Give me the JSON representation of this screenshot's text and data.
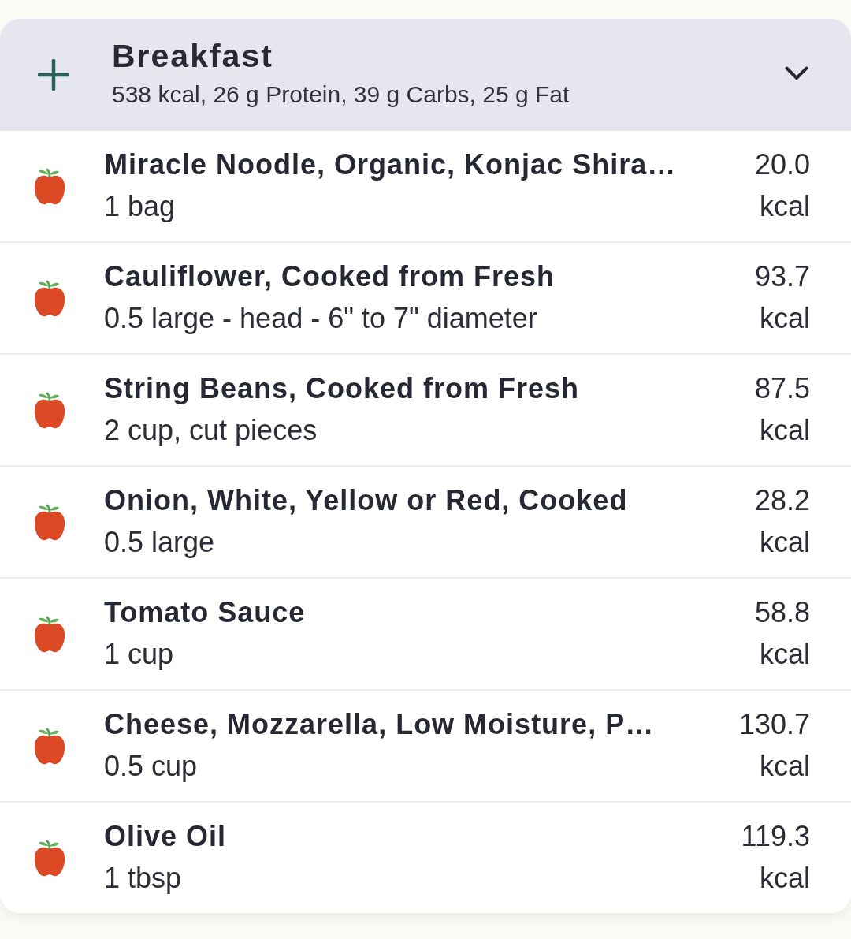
{
  "meal": {
    "title": "Breakfast",
    "summary": "538 kcal, 26 g Protein, 39 g Carbs, 25 g Fat"
  },
  "items": [
    {
      "name": "Miracle Noodle, Organic, Konjac Shira…",
      "serving": "1 bag",
      "calories": "20.0",
      "unit": "kcal"
    },
    {
      "name": "Cauliflower, Cooked from Fresh",
      "serving": "0.5 large - head - 6\" to 7\" diameter",
      "calories": "93.7",
      "unit": "kcal"
    },
    {
      "name": "String Beans, Cooked from Fresh",
      "serving": "2 cup, cut pieces",
      "calories": "87.5",
      "unit": "kcal"
    },
    {
      "name": "Onion, White, Yellow or Red, Cooked",
      "serving": "0.5 large",
      "calories": "28.2",
      "unit": "kcal"
    },
    {
      "name": "Tomato Sauce",
      "serving": "1 cup",
      "calories": "58.8",
      "unit": "kcal"
    },
    {
      "name": "Cheese, Mozzarella, Low Moisture, P…",
      "serving": "0.5 cup",
      "calories": "130.7",
      "unit": "kcal"
    },
    {
      "name": "Olive Oil",
      "serving": "1 tbsp",
      "calories": "119.3",
      "unit": "kcal"
    }
  ]
}
